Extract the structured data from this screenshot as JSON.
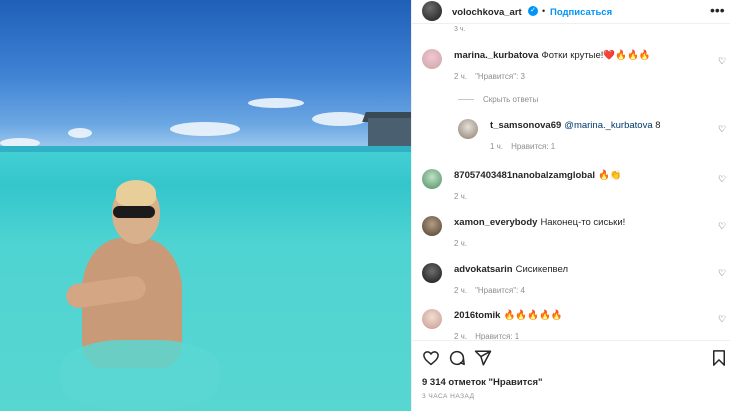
{
  "header": {
    "username": "volochkova_art",
    "separator": "•",
    "follow_label": "Подписаться",
    "more_icon": "more-icon"
  },
  "partial_top_meta": "3 ч.",
  "comments": [
    {
      "username": "marina._kurbatova",
      "text": "Фотки крутые!❤️🔥🔥🔥",
      "time": "2 ч.",
      "likes": "\"Нравится\": 3"
    },
    {
      "username": "87057403481nanobalzamglobal",
      "text": "🔥👏",
      "time": "2 ч.",
      "likes": ""
    },
    {
      "username": "xamon_everybody",
      "text": "Наконец-то сиськи!",
      "time": "2 ч.",
      "likes": ""
    },
    {
      "username": "advokatsarin",
      "text": "Сисикепвел",
      "time": "2 ч.",
      "likes": "\"Нравится\": 4"
    },
    {
      "username": "2016tomik",
      "text": "🔥🔥🔥🔥🔥",
      "time": "2 ч.",
      "likes": "Нравится: 1"
    }
  ],
  "reply_toggle": "Скрыть ответы",
  "reply": {
    "username": "t_samsonova69",
    "mention": "@marina._kurbatova",
    "text": "8",
    "time": "1 ч.",
    "likes": "Нравится: 1"
  },
  "likes_count": "9 314 отметок \"Нравится\"",
  "time_ago": "3 ЧАСА НАЗАД",
  "colors": {
    "accent": "#0095f6",
    "muted": "#8e8e8e",
    "text": "#262626"
  }
}
